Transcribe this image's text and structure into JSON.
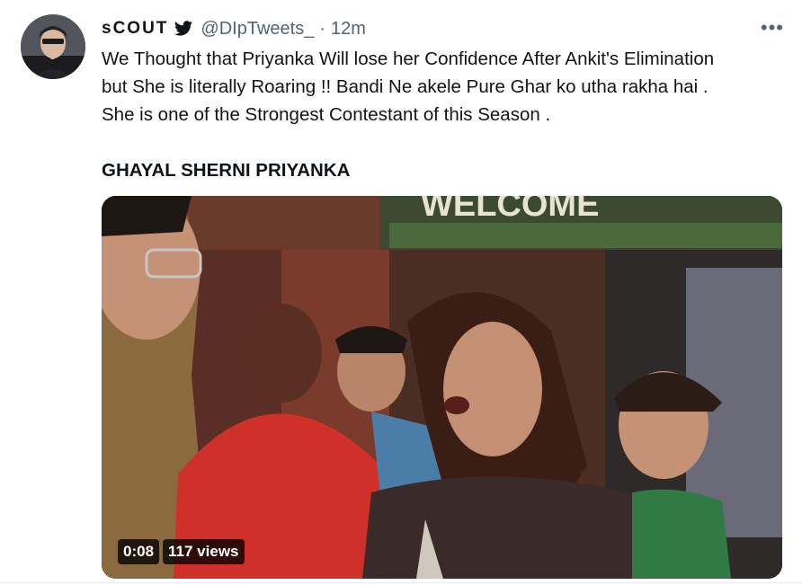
{
  "tweet": {
    "display_name": "sCOUT",
    "handle": "@DIpTweets_",
    "separator": "·",
    "time": "12m",
    "more_label": "•••",
    "text_lines": [
      "We Thought that Priyanka Will lose her Confidence After Ankit's Elimination",
      "but She is literally Roaring !! Bandi Ne akele Pure Ghar ko utha rakha hai .",
      "She is one of the Strongest Contestant of this Season ."
    ],
    "caps_line": "GHAYAL SHERNI PRIYANKA"
  },
  "media": {
    "sign_text": "WELCOME",
    "duration": "0:08",
    "views": "117 views"
  },
  "colors": {
    "text": "#0f1419",
    "secondary": "#536471",
    "overlay": "#000000"
  },
  "icons": {
    "bird": "twitter-bird-icon",
    "more": "more-horizontal-icon"
  }
}
